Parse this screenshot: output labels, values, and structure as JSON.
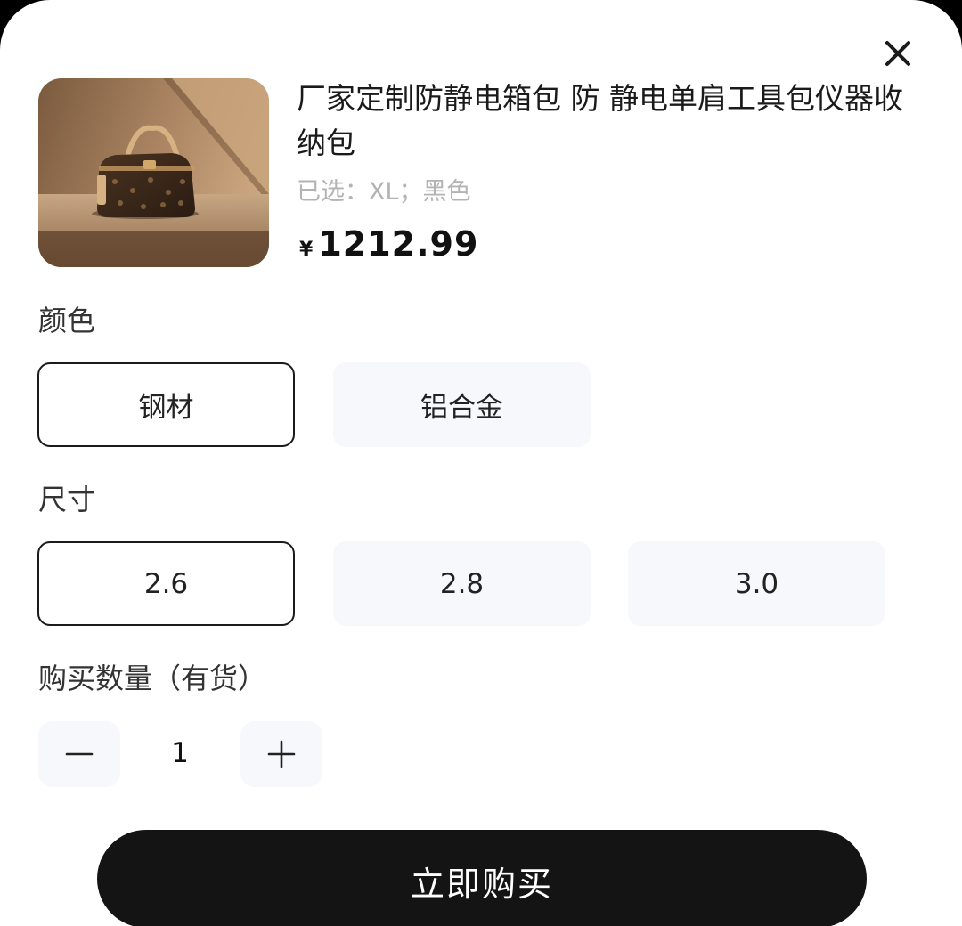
{
  "product": {
    "title": "厂家定制防静电箱包 防 静电单肩工具包仪器收纳包",
    "selected_text": "已选：XL；黑色",
    "currency_symbol": "¥",
    "price": "1212.99",
    "image_icon": "handbag-photo"
  },
  "sections": {
    "color_label": "颜色",
    "size_label": "尺寸",
    "quantity_label": "购买数量（有货）"
  },
  "color_options": [
    {
      "label": "钢材",
      "selected": true
    },
    {
      "label": "铝合金",
      "selected": false
    }
  ],
  "size_options": [
    {
      "label": "2.6",
      "selected": true
    },
    {
      "label": "2.8",
      "selected": false
    },
    {
      "label": "3.0",
      "selected": false
    }
  ],
  "quantity": {
    "value": "1",
    "minus_icon": "minus-icon",
    "plus_icon": "plus-icon"
  },
  "actions": {
    "buy_now": "立即购买",
    "close_icon": "close-icon"
  },
  "colors": {
    "selected_border": "#1b1b1b",
    "option_bg": "#f6f8fb",
    "button_bg": "#141414",
    "muted_text": "#b3b3b3"
  }
}
